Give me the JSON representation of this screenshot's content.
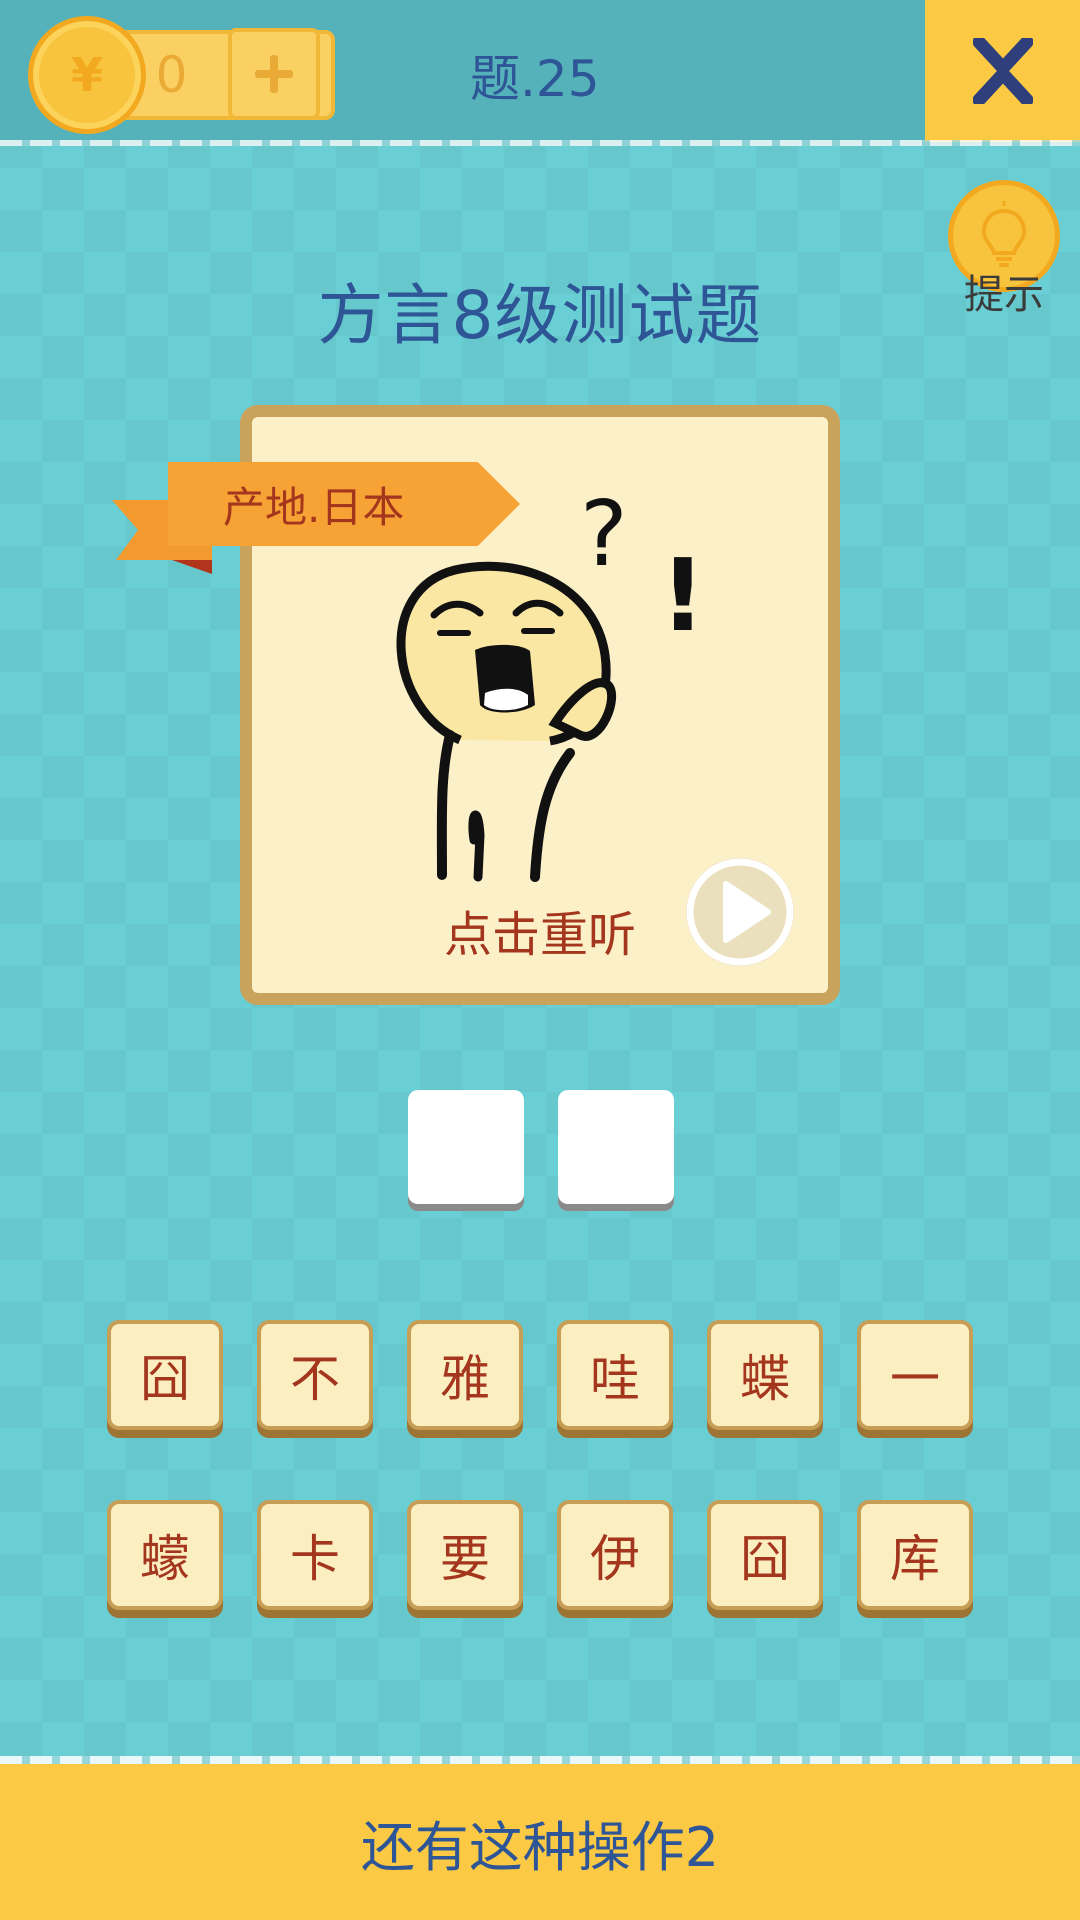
{
  "header": {
    "coin_symbol": "¥",
    "coin_count": "0",
    "plus_symbol": "+",
    "question_label": "题.25",
    "close_label": "X"
  },
  "hint": {
    "label": "提示",
    "icon": "lightbulb-icon"
  },
  "title": "方言8级测试题",
  "card": {
    "origin_tag": "产地.日本",
    "replay_label": "点击重听",
    "play_icon": "play-icon",
    "figure_marks": {
      "question": "?",
      "exclaim": "!"
    }
  },
  "answer_slots": [
    "",
    ""
  ],
  "tiles": {
    "row1": [
      "囧",
      "不",
      "雅",
      "哇",
      "蝶",
      "一"
    ],
    "row2": [
      "蠓",
      "卡",
      "要",
      "伊",
      "囧",
      "库"
    ]
  },
  "footer": {
    "label": "还有这种操作2"
  },
  "colors": {
    "background": "#6acfd5",
    "title_blue": "#2e5596",
    "tile_text": "#a5361e",
    "gold": "#fbc944"
  }
}
